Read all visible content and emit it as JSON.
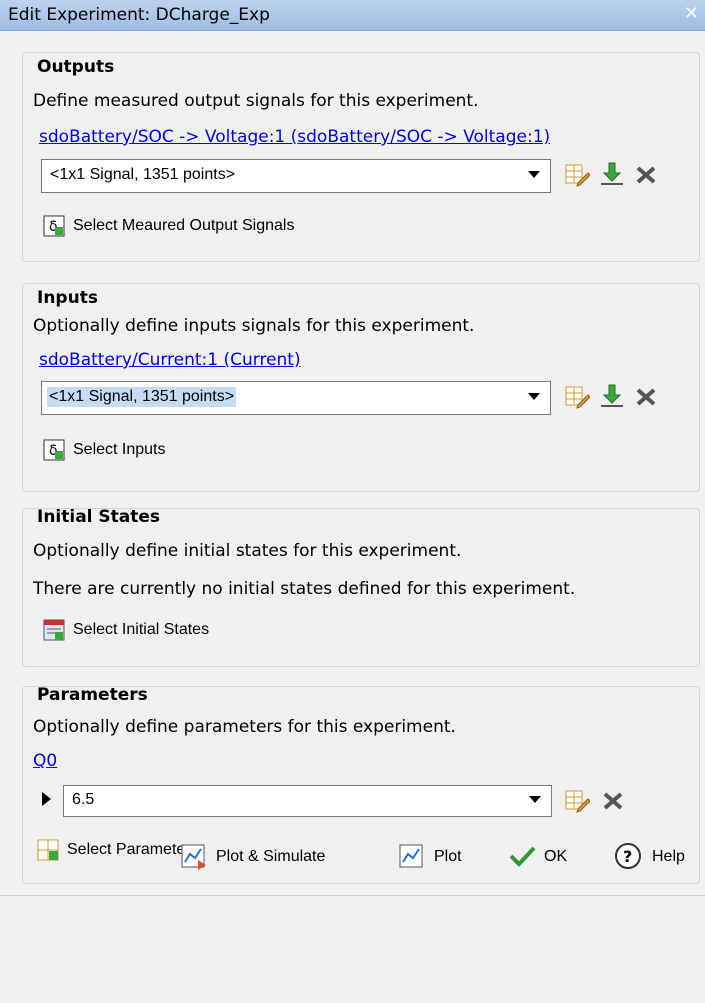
{
  "window": {
    "title": "Edit Experiment: DCharge_Exp",
    "close_glyph": "✕"
  },
  "outputs": {
    "title": "Outputs",
    "description": "Define measured output signals for this experiment.",
    "link": "sdoBattery/SOC -> Voltage:1 (sdoBattery/SOC -> Voltage:1)",
    "combo_value": "<1x1 Signal, 1351 points>",
    "select_button": "Select Meaured Output Signals"
  },
  "inputs": {
    "title": "Inputs",
    "description": "Optionally define inputs signals for this experiment.",
    "link": "sdoBattery/Current:1 (Current)",
    "combo_value": "<1x1 Signal, 1351 points>",
    "select_button": "Select Inputs"
  },
  "initial_states": {
    "title": "Initial States",
    "description": "Optionally define initial states for this experiment.",
    "info": "There are currently no initial states defined for this experiment.",
    "select_button": "Select Initial States"
  },
  "parameters": {
    "title": "Parameters",
    "description": "Optionally define parameters for this experiment.",
    "link": "Q0",
    "combo_value": "6.5",
    "select_button": "Select Parameters"
  },
  "footer": {
    "plot_simulate": "Plot & Simulate",
    "plot": "Plot",
    "ok": "OK",
    "help": "Help"
  },
  "colors": {
    "link": "#0000ee",
    "title_bar": "#9fbde3",
    "ok_check": "#2e9a2e"
  }
}
